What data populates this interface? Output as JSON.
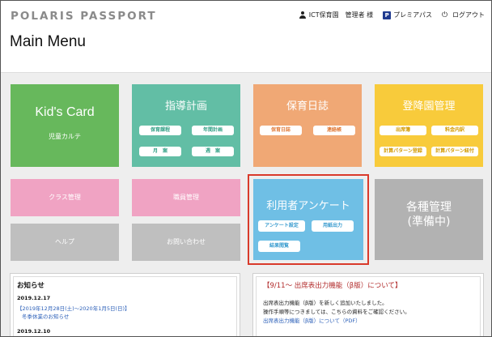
{
  "header": {
    "logo_text": "POLARIS PASSPORT",
    "user_label": "ICT保育園　管理者 様",
    "premium_label": "プレミアパス",
    "premium_icon_letter": "P",
    "logout_label": "ログアウト",
    "logout_icon": "⏻"
  },
  "page": {
    "title": "Main Menu"
  },
  "tiles": {
    "kids_card": {
      "title": "Kid's Card",
      "subtitle": "児童カルテ",
      "color": "#67b85c"
    },
    "shido": {
      "title": "指導計画",
      "buttons": [
        "保育課程",
        "年間計画",
        "月　案",
        "週　案"
      ],
      "color": "#62bea5"
    },
    "hoiku": {
      "title": "保育日誌",
      "buttons": [
        "保育日誌",
        "連絡帳"
      ],
      "color": "#f0a875"
    },
    "tokoen": {
      "title": "登降園管理",
      "buttons": [
        "出席簿",
        "料金内訳",
        "計算パターン登録",
        "計算パターン紐付"
      ],
      "color": "#f8cb3b"
    },
    "class": {
      "title": "クラス管理",
      "color": "#f0a3c3"
    },
    "staff": {
      "title": "職員管理",
      "color": "#f0a3c3"
    },
    "survey": {
      "title": "利用者アンケート",
      "buttons": [
        "アンケート設定",
        "用紙出力",
        "結果閲覧"
      ],
      "color": "#6fbfe5"
    },
    "kakushu": {
      "title_line1": "各種管理",
      "title_line2": "(準備中)",
      "color": "#b2b2b2"
    },
    "help": {
      "title": "ヘルプ",
      "color": "#bfbfbf"
    },
    "contact": {
      "title": "お問い合わせ",
      "color": "#bfbfbf"
    }
  },
  "news": {
    "title": "お知らせ",
    "items": [
      {
        "date": "2019.12.17",
        "link1": "【2019年12月28日(土)〜2020年1月5日(日)】",
        "link2": "冬季休業のお知らせ"
      },
      {
        "date": "2019.12.10",
        "link1": "【"
      }
    ]
  },
  "notice": {
    "title": "【9/11〜 出席表出力機能（β版）について】",
    "line1": "出席表出力機能（β版）を新しく追加いたしました。",
    "line2": "操作手順等につきましては、こちらの資料をご確認ください。",
    "link": "出席表出力機能（β版）について（PDF）"
  },
  "colors": {
    "highlight": "#d93a2b",
    "link": "#2b5fb8",
    "notice_title": "#b12a2a"
  }
}
